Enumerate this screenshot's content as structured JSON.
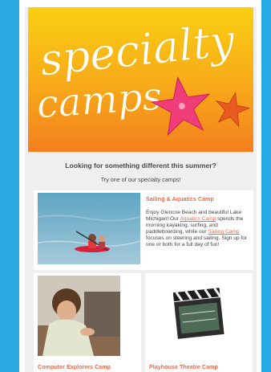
{
  "hero": {
    "title_line1": "specialty",
    "title_line2": "camps",
    "bg_top": "#f7c511",
    "bg_bottom": "#f68a1e"
  },
  "intro": {
    "headline": "Looking for something different this summer?",
    "subline": "Try one of our specialty camps!"
  },
  "camps": {
    "sailing": {
      "title": "Sailing & Aquatics Camp",
      "desc_1": "Enjoy Glencoe Beach and beautiful Lake Michigan! Our ",
      "link_1": "Aquatics Camp",
      "desc_2": " spends the morning kayaking, surfing, and paddleboarding, while our ",
      "link_2": "Sailing Camp",
      "desc_3": " focuses on steering and sailing. Sign up for one or both for a full day of fun!"
    },
    "computer": {
      "title": "Computer Explorers Camp"
    },
    "theatre": {
      "title": "Playhouse Theatre Camp"
    }
  },
  "colors": {
    "accent": "#e76c4b",
    "page_bg": "#29a9e1",
    "panel_bg": "#efefef"
  }
}
